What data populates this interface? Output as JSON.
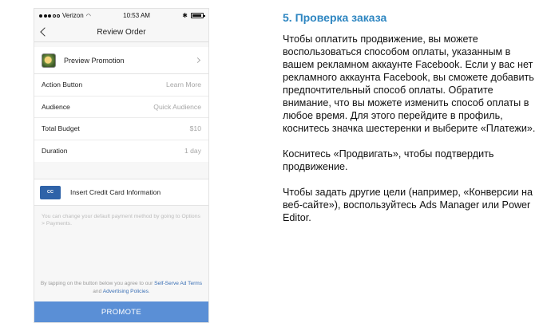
{
  "status_bar": {
    "carrier": "Verizon",
    "time": "10:53 AM"
  },
  "nav": {
    "title": "Review Order"
  },
  "promotion": {
    "label": "Preview Promotion"
  },
  "details": [
    {
      "label": "Action Button",
      "value": "Learn More"
    },
    {
      "label": "Audience",
      "value": "Quick Audience"
    },
    {
      "label": "Total Budget",
      "value": "$10"
    },
    {
      "label": "Duration",
      "value": "1 day"
    }
  ],
  "card": {
    "icon_text": "CC",
    "label": "Insert Credit Card Information"
  },
  "help_text": "You can change your default payment method by going to Options > Payments.",
  "terms": {
    "prefix": "By tapping on the button below you agree to our ",
    "link1": "Self-Serve Ad Terms",
    "middle": " and ",
    "link2": "Advertising Policies",
    "suffix": "."
  },
  "promote_button": "PROMOTE",
  "article": {
    "heading": "5. Проверка заказа",
    "paragraphs": [
      "Чтобы оплатить продвижение, вы можете воспользоваться способом оплаты, указанным в вашем рекламном аккаунте Facebook. Если у вас нет рекламного аккаунта Facebook, вы сможете добавить предпочтительный способ оплаты. Обратите внимание, что вы можете изменить способ оплаты в любое время. Для этого перейдите в профиль, коснитесь значка шестеренки и выберите «Платежи».",
      "Коснитесь «Продвигать», чтобы подтвердить продвижение.",
      "Чтобы задать другие цели (например, «Конверсии на веб-сайте»), воспользуйтесь Ads Manager или Power Editor."
    ]
  },
  "colors": {
    "accent": "#2e86c1",
    "button": "#5a8fd6",
    "card_icon": "#2f63a8"
  }
}
